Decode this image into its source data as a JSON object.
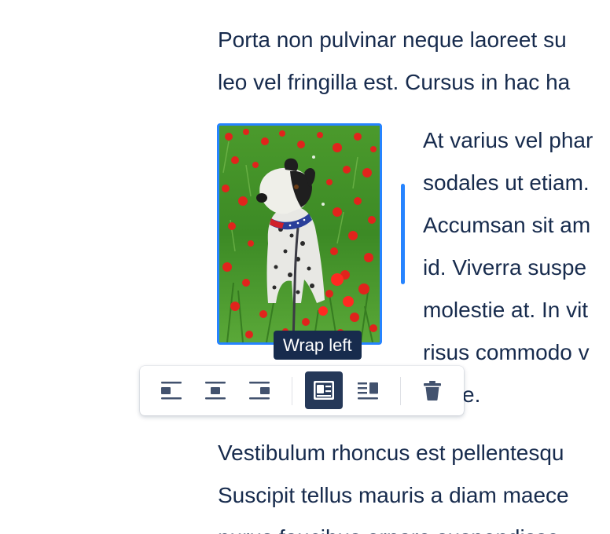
{
  "document": {
    "paragraph1": [
      "Porta non pulvinar neque laoreet su",
      "leo vel fringilla est. Cursus in hac ha"
    ],
    "wrapped_paragraph": [
      "At varius vel phar",
      "sodales ut etiam.",
      "Accumsan sit am",
      "id. Viverra suspe",
      "molestie at. In vit",
      "risus commodo v",
      "e."
    ],
    "paragraph3": [
      "Vestibulum rhoncus est pellentesqu",
      "Suscipit tellus mauris a diam maece",
      "purus faucibus ornare suspendisse"
    ]
  },
  "image": {
    "alt": "Dog sitting in a field of red poppies",
    "selected": true,
    "border_color": "#2684FF"
  },
  "tooltip": {
    "text": "Wrap left"
  },
  "toolbar": {
    "buttons": [
      {
        "name": "align-left",
        "icon": "align-image-left-icon",
        "active": false
      },
      {
        "name": "align-center",
        "icon": "align-image-center-icon",
        "active": false
      },
      {
        "name": "align-right",
        "icon": "align-image-right-icon",
        "active": false
      },
      {
        "name": "wrap-left",
        "icon": "wrap-left-icon",
        "active": true
      },
      {
        "name": "wrap-right",
        "icon": "wrap-right-icon",
        "active": false
      },
      {
        "name": "remove",
        "icon": "trash-icon",
        "active": false
      }
    ],
    "active_color": "#253858",
    "icon_color": "#42526E"
  }
}
